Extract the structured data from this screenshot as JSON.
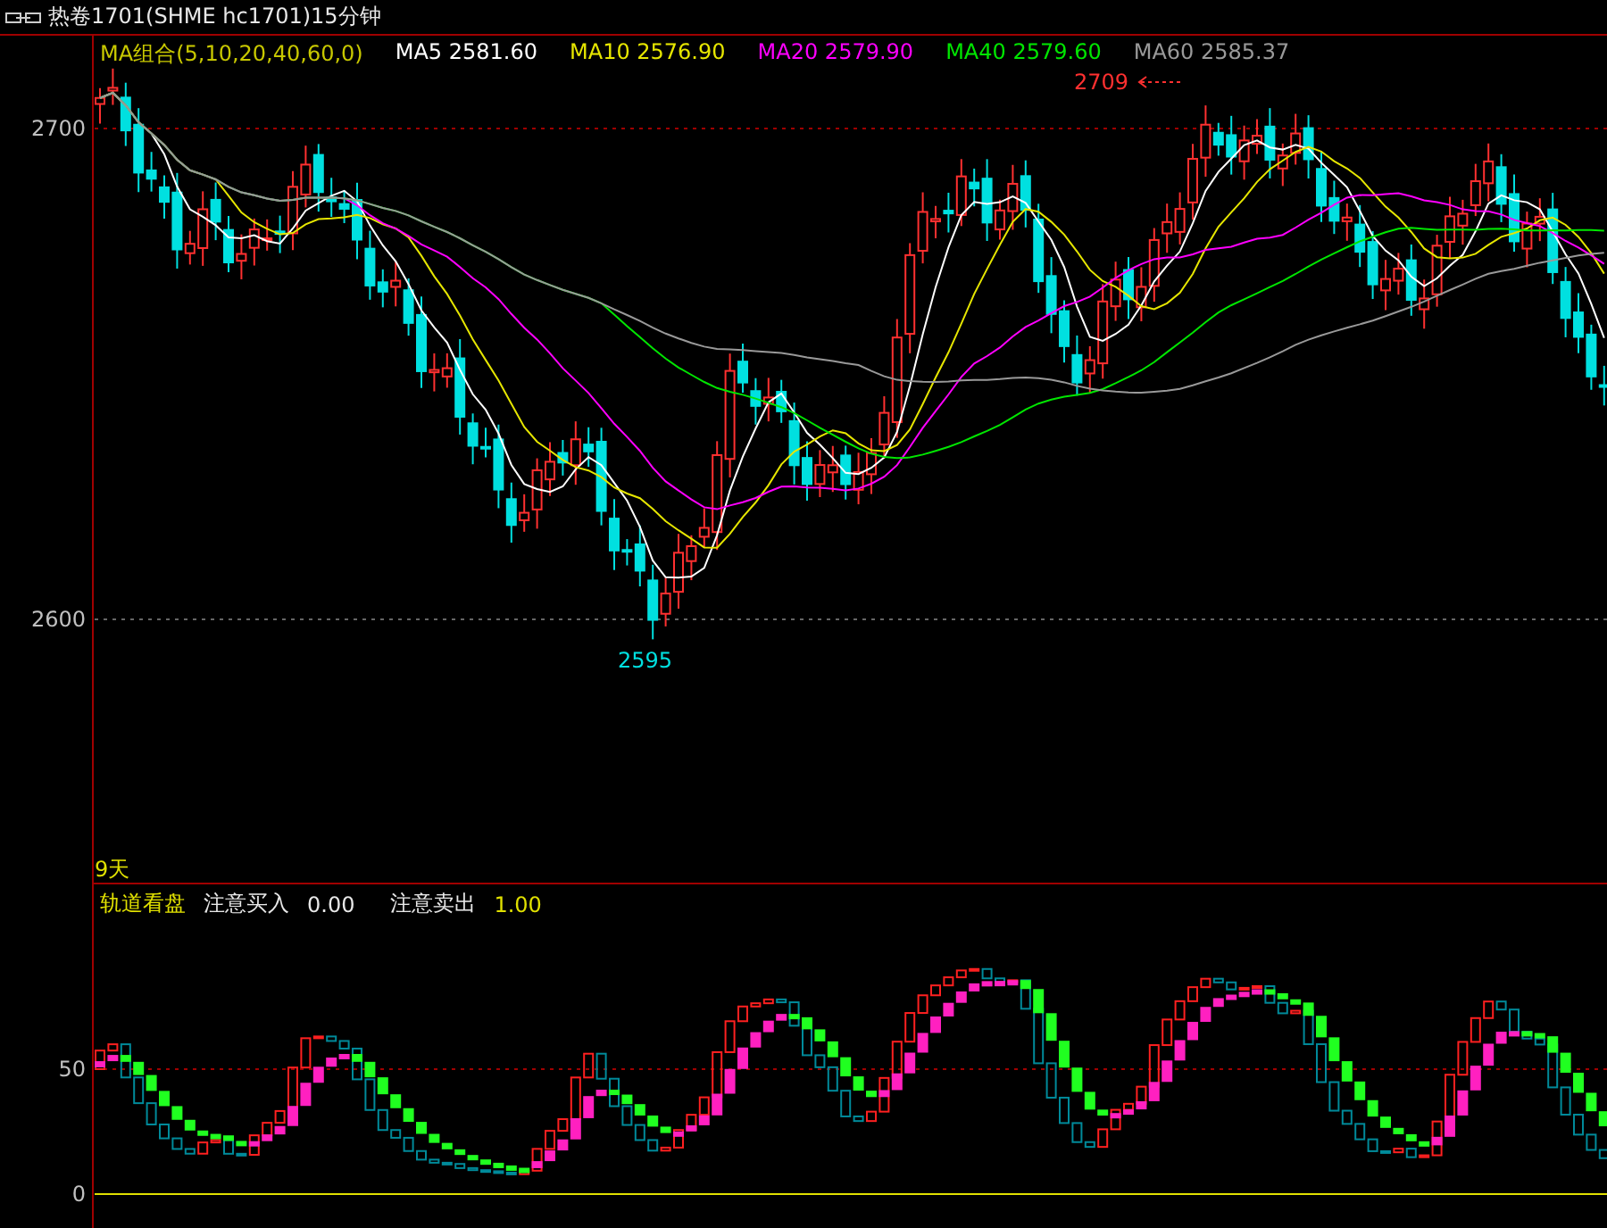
{
  "window": {
    "title": "热卷1701(SHME hc1701)15分钟"
  },
  "legend": [
    {
      "label": "MA组合(5,10,20,40,60,0)",
      "color": "#c8c800"
    },
    {
      "label": "MA5 2581.60",
      "color": "#ffffff"
    },
    {
      "label": "MA10 2576.90",
      "color": "#e6e600"
    },
    {
      "label": "MA20 2579.90",
      "color": "#ff00ff"
    },
    {
      "label": "MA40 2579.60",
      "color": "#00e600"
    },
    {
      "label": "MA60 2585.37",
      "color": "#999999"
    }
  ],
  "main_chart": {
    "yticks": [
      "2700",
      "2600"
    ],
    "high_label": "2709",
    "low_label": "2595"
  },
  "period_label": "9天",
  "indicator": {
    "name": "轨道看盘",
    "items": [
      {
        "label": "注意买入",
        "value": "0.00"
      },
      {
        "label": "注意卖出",
        "value": "1.00"
      }
    ],
    "yticks": [
      "50",
      "0"
    ]
  }
}
